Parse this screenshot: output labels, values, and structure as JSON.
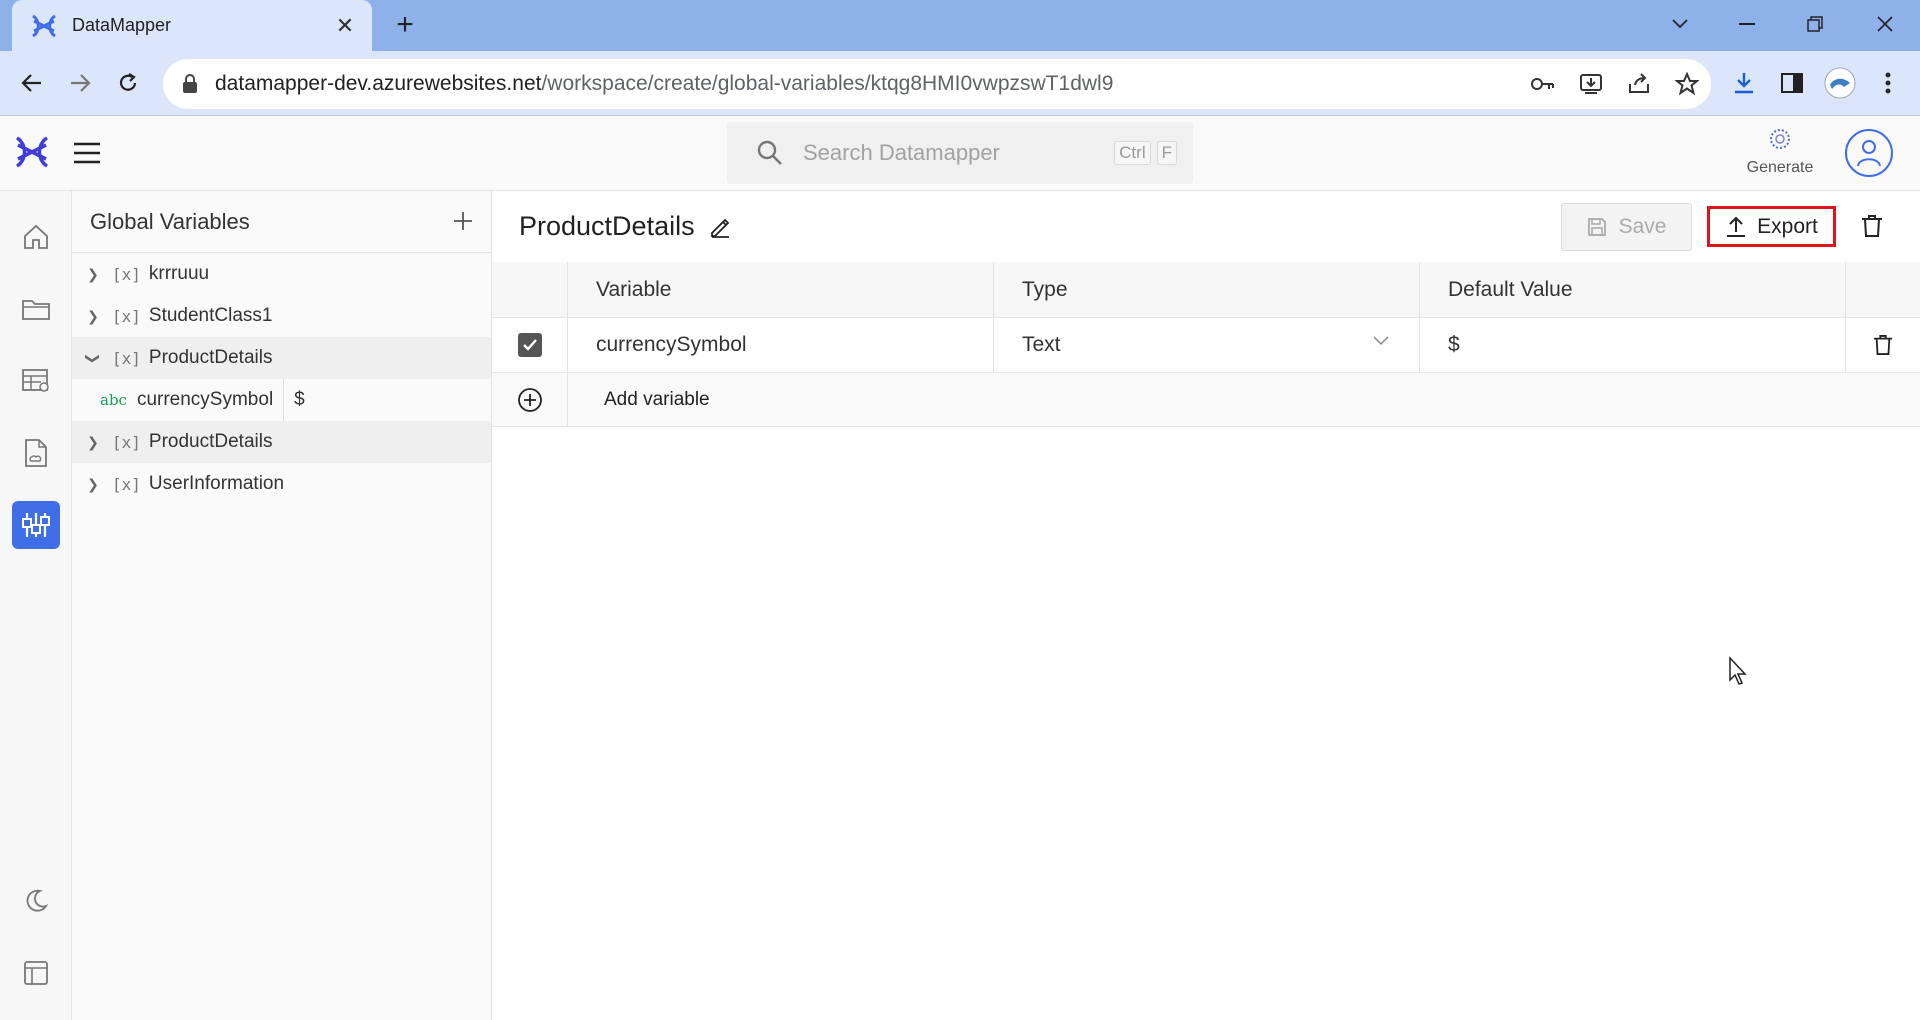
{
  "browser": {
    "tab_title": "DataMapper",
    "url_host": "datamapper-dev.azurewebsites.net",
    "url_path": "/workspace/create/global-variables/ktqg8HMI0vwpzswT1dwl9"
  },
  "header": {
    "search_placeholder": "Search Datamapper",
    "shortcut_ctrl": "Ctrl",
    "shortcut_key": "F",
    "generate_label": "Generate"
  },
  "tree": {
    "title": "Global Variables",
    "var_marker": "[x]",
    "type_marker": "abc",
    "items": [
      {
        "label": "krrruuu"
      },
      {
        "label": "StudentClass1"
      },
      {
        "label": "ProductDetails"
      },
      {
        "label": "ProductDetails"
      },
      {
        "label": "UserInformation"
      }
    ],
    "child": {
      "name": "currencySymbol",
      "value": "$"
    }
  },
  "main": {
    "title": "ProductDetails",
    "save_label": "Save",
    "export_label": "Export",
    "columns": [
      "Variable",
      "Type",
      "Default Value"
    ],
    "row": {
      "variable": "currencySymbol",
      "type": "Text",
      "default": "$"
    },
    "add_label": "Add variable"
  },
  "colors": {
    "accent": "#3f6ee8",
    "highlight": "#e0141e",
    "chrome": "#8fb1ea"
  }
}
